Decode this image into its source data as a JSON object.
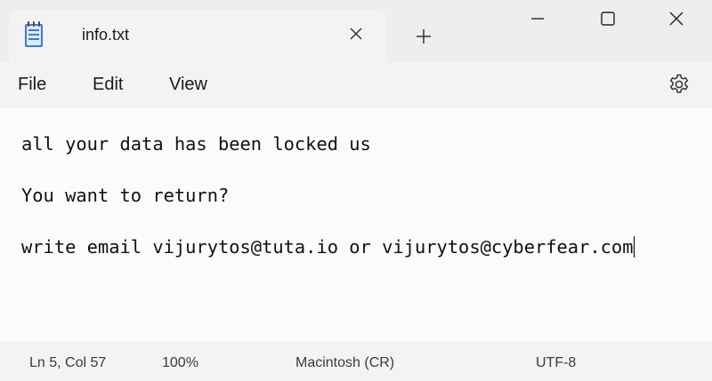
{
  "tab": {
    "title": "info.txt",
    "icon": "notepad-icon"
  },
  "window_controls": {
    "minimize_icon": "minimize-icon",
    "maximize_icon": "maximize-icon",
    "close_icon": "close-icon",
    "new_tab_icon": "plus-icon",
    "tab_close_icon": "close-icon"
  },
  "menu": {
    "file": "File",
    "edit": "Edit",
    "view": "View",
    "settings_icon": "gear-icon"
  },
  "document": {
    "lines": [
      "all your data has been locked us",
      "You want to return?",
      "write email vijurytos@tuta.io or vijurytos@cyberfear.com"
    ]
  },
  "status": {
    "position": "Ln 5, Col 57",
    "zoom": "100%",
    "line_ending": "Macintosh (CR)",
    "encoding": "UTF-8"
  },
  "colors": {
    "title_bar": "#eeeeee",
    "menu_bar": "#f3f3f3",
    "editor_bg": "#fbfbfb",
    "text": "#111111",
    "icon_blue": "#3b7bd4"
  }
}
